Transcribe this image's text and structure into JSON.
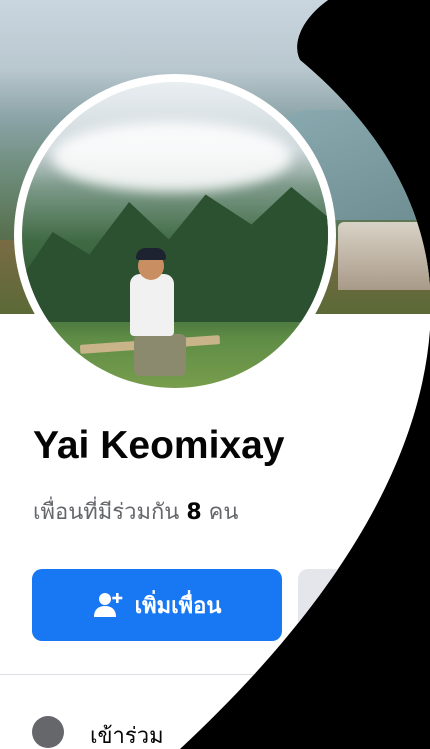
{
  "profile": {
    "name": "Yai Keomixay",
    "mutual_prefix": "เพื่อนที่มีร่วมกัน",
    "mutual_count": "8",
    "mutual_suffix": "คน"
  },
  "actions": {
    "add_friend_label": "เพิ่มเพื่อน",
    "add_friend_icon": "add-friend-icon"
  },
  "details": {
    "joined_text": "เข้าร่วม"
  },
  "colors": {
    "accent": "#1877f2",
    "secondary_button": "#e4e6eb",
    "text_primary": "#050505",
    "text_secondary": "#65676b"
  }
}
